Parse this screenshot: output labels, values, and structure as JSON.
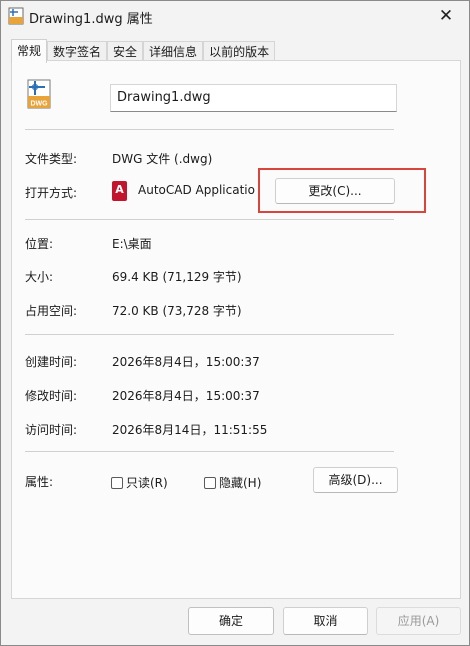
{
  "window": {
    "title": "Drawing1.dwg 属性",
    "close_glyph": "✕"
  },
  "tabs": [
    {
      "label": "常规",
      "active": true
    },
    {
      "label": "数字签名",
      "active": false
    },
    {
      "label": "安全",
      "active": false
    },
    {
      "label": "详细信息",
      "active": false
    },
    {
      "label": "以前的版本",
      "active": false
    }
  ],
  "file": {
    "icon": "dwg-file-icon",
    "icon_text": "DWG",
    "name": "Drawing1.dwg"
  },
  "props": {
    "type_label": "文件类型:",
    "type_value": "DWG 文件 (.dwg)",
    "open_with_label": "打开方式:",
    "open_with_icon_letter": "A",
    "open_with_value": "AutoCAD Application",
    "change_button": "更改(C)...",
    "location_label": "位置:",
    "location_value": "E:\\桌面",
    "size_label": "大小:",
    "size_value": "69.4 KB (71,129 字节)",
    "disk_label": "占用空间:",
    "disk_value": "72.0 KB (73,728 字节)",
    "created_label": "创建时间:",
    "created_value": "2026年8月4日，15:00:37",
    "modified_label": "修改时间:",
    "modified_value": "2026年8月4日，15:00:37",
    "accessed_label": "访问时间:",
    "accessed_value": "2026年8月14日，11:51:55",
    "attributes_label": "属性:",
    "readonly_label": "只读(R)",
    "hidden_label": "隐藏(H)",
    "advanced_button": "高级(D)..."
  },
  "footer": {
    "ok": "确定",
    "cancel": "取消",
    "apply": "应用(A)"
  },
  "colors": {
    "highlight": "#d9453c",
    "autocad_red": "#c3142d",
    "dwg_blue": "#2a6fb8",
    "dwg_orange": "#e8a33a"
  }
}
